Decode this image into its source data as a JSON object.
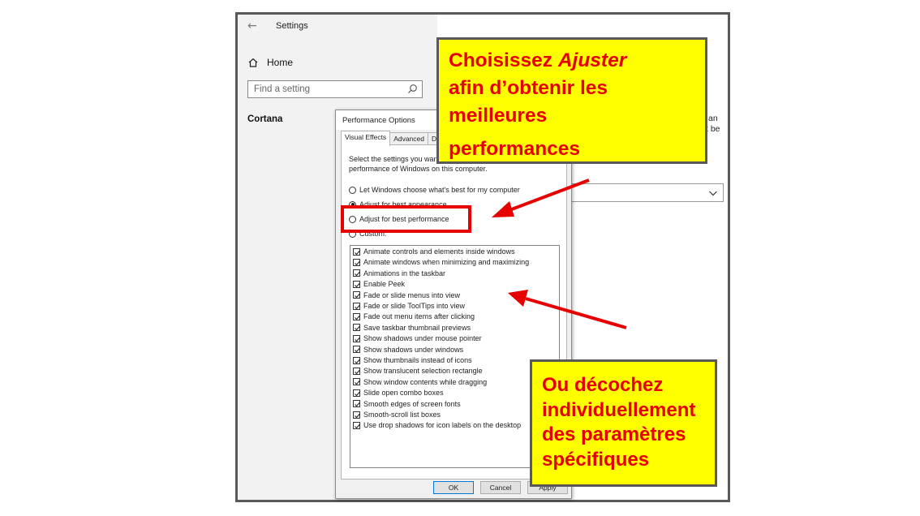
{
  "settings": {
    "title": "Settings",
    "home_label": "Home",
    "search_placeholder": "Find a setting",
    "section_label": "Cortana",
    "right_fragments": [
      "an",
      "t be"
    ]
  },
  "dialog": {
    "title": "Performance Options",
    "tabs": [
      {
        "label": "Visual Effects",
        "active": true
      },
      {
        "label": "Advanced",
        "active": false
      },
      {
        "label": "Data E",
        "active": false
      }
    ],
    "instruction_line1": "Select the settings you want to use for the appearance and",
    "instruction_line2": "performance of Windows on this computer.",
    "radios": [
      {
        "label": "Let Windows choose what's best for my computer",
        "selected": false
      },
      {
        "label": "Adjust for best appearance",
        "selected": true
      },
      {
        "label": "Adjust for best performance",
        "selected": false
      },
      {
        "label": "Custom:",
        "selected": false
      }
    ],
    "checkboxes": [
      {
        "label": "Animate controls and elements inside windows",
        "checked": true
      },
      {
        "label": "Animate windows when minimizing and maximizing",
        "checked": true
      },
      {
        "label": "Animations in the taskbar",
        "checked": true
      },
      {
        "label": "Enable Peek",
        "checked": true
      },
      {
        "label": "Fade or slide menus into view",
        "checked": true
      },
      {
        "label": "Fade or slide ToolTips into view",
        "checked": true
      },
      {
        "label": "Fade out menu items after clicking",
        "checked": true
      },
      {
        "label": "Save taskbar thumbnail previews",
        "checked": true
      },
      {
        "label": "Show shadows under mouse pointer",
        "checked": true
      },
      {
        "label": "Show shadows under windows",
        "checked": true
      },
      {
        "label": "Show thumbnails instead of icons",
        "checked": true
      },
      {
        "label": "Show translucent selection rectangle",
        "checked": true
      },
      {
        "label": "Show window contents while dragging",
        "checked": true
      },
      {
        "label": "Slide open combo boxes",
        "checked": true
      },
      {
        "label": "Smooth edges of screen fonts",
        "checked": true
      },
      {
        "label": "Smooth-scroll list boxes",
        "checked": true
      },
      {
        "label": "Use drop shadows for icon labels on the desktop",
        "checked": true
      }
    ],
    "buttons": {
      "ok": "OK",
      "cancel": "Cancel",
      "apply": "Apply"
    }
  },
  "callouts": {
    "top": {
      "line1_prefix": "Choisissez ",
      "line1_emphasis": "Ajuster",
      "line2": "afin d’obtenir les",
      "line3": "meilleures",
      "line4": "performances"
    },
    "bottom": {
      "line1": "Ou décochez",
      "line2": "individuellement",
      "line3": "des paramètres",
      "line4": "spécifiques"
    }
  },
  "colors": {
    "callout_bg": "#ffff00",
    "callout_text": "#e60000",
    "arrow": "#e60000",
    "frame_border": "#595959",
    "settings_sidebar": "#f2f2f2"
  }
}
